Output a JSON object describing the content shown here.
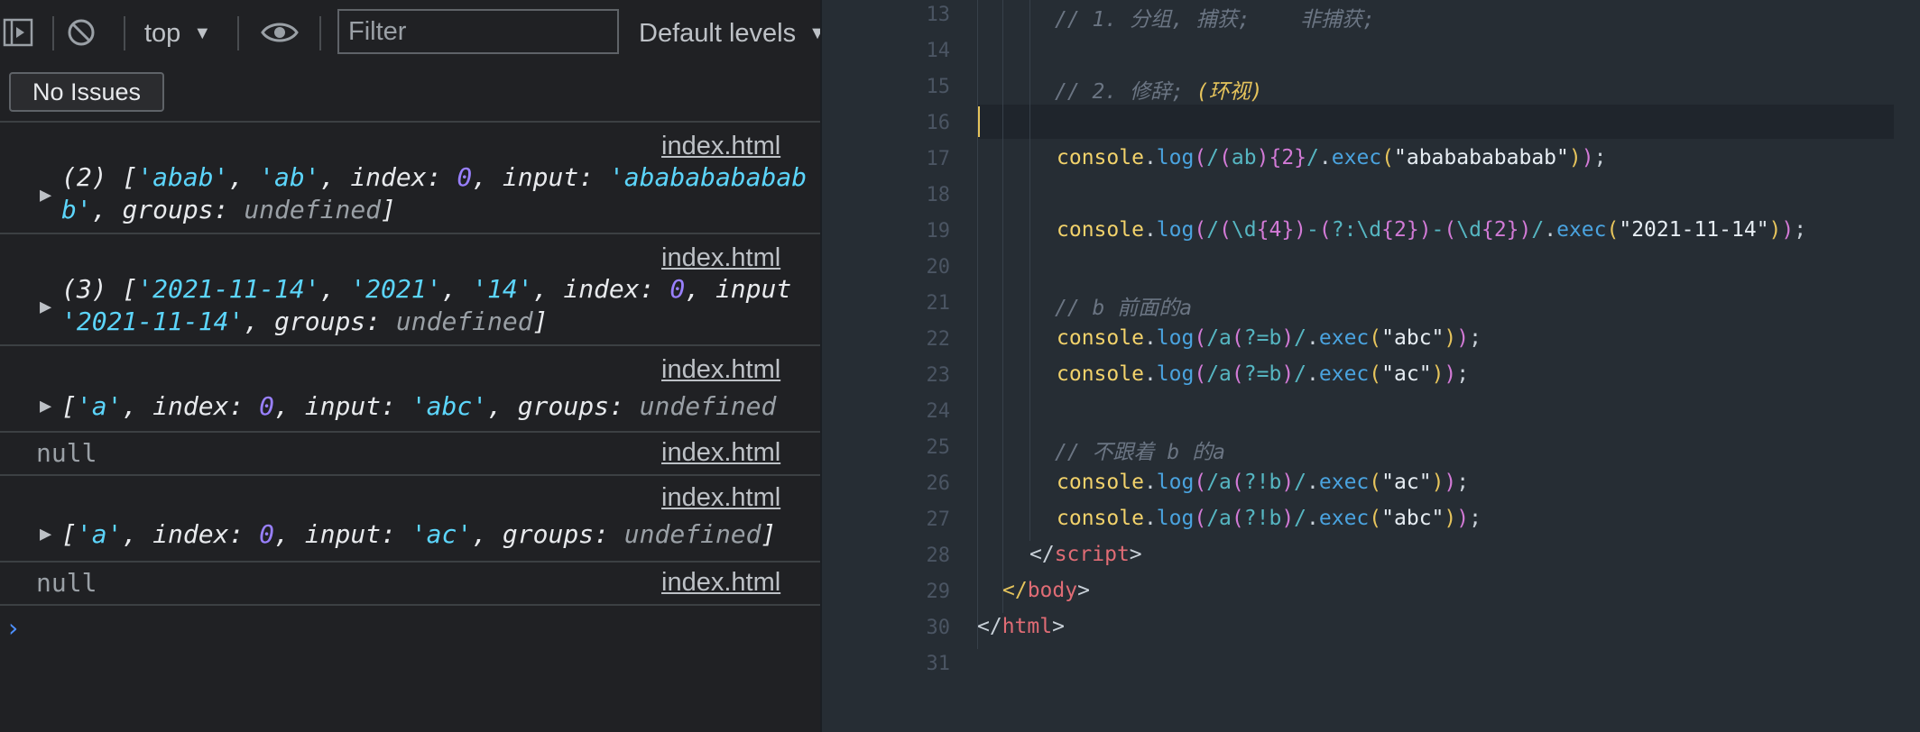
{
  "toolbar": {
    "context": "top",
    "filter_placeholder": "Filter",
    "levels": "Default levels",
    "issues": "No Issues"
  },
  "console": {
    "source": "index.html",
    "messages": [
      {
        "count": "(2)",
        "l1": [
          "'abab'",
          "'ab'",
          "0",
          "'abababababab"
        ],
        "l2": [
          "b'",
          "undefined"
        ]
      },
      {
        "count": "(3)",
        "l1": [
          "'2021-11-14'",
          "'2021'",
          "'14'",
          "0"
        ],
        "l2": [
          "'2021-11-14'",
          "undefined"
        ]
      },
      {
        "l1": [
          "'a'",
          "0",
          "'abc'",
          "undefined"
        ]
      },
      {
        "null": "null"
      },
      {
        "l1": [
          "'a'",
          "0",
          "'ac'",
          "undefined"
        ]
      },
      {
        "null": "null"
      }
    ],
    "keys": {
      "index": "index",
      "input": "input",
      "groups": "groups"
    }
  },
  "editor": {
    "line_numbers": [
      "13",
      "14",
      "15",
      "16",
      "17",
      "18",
      "19",
      "20",
      "21",
      "22",
      "23",
      "24",
      "25",
      "26",
      "27",
      "28",
      "29",
      "30",
      "31"
    ],
    "comments": {
      "l13": "// 1. 分组, 捕获;    非捕获;",
      "l15a": "// 2. 修辞; ",
      "l15b": "(环视)",
      "l21": "// b 前面的a",
      "l25": "// 不跟着 b 的a"
    },
    "console": "console",
    "log": "log",
    "exec": "exec",
    "strings": {
      "l17": "abababababab",
      "l19": "2021-11-14",
      "l22": "abc",
      "l23": "ac",
      "l26": "ac",
      "l27": "abc"
    },
    "tags": {
      "script": "script",
      "body": "body",
      "html": "html"
    }
  }
}
